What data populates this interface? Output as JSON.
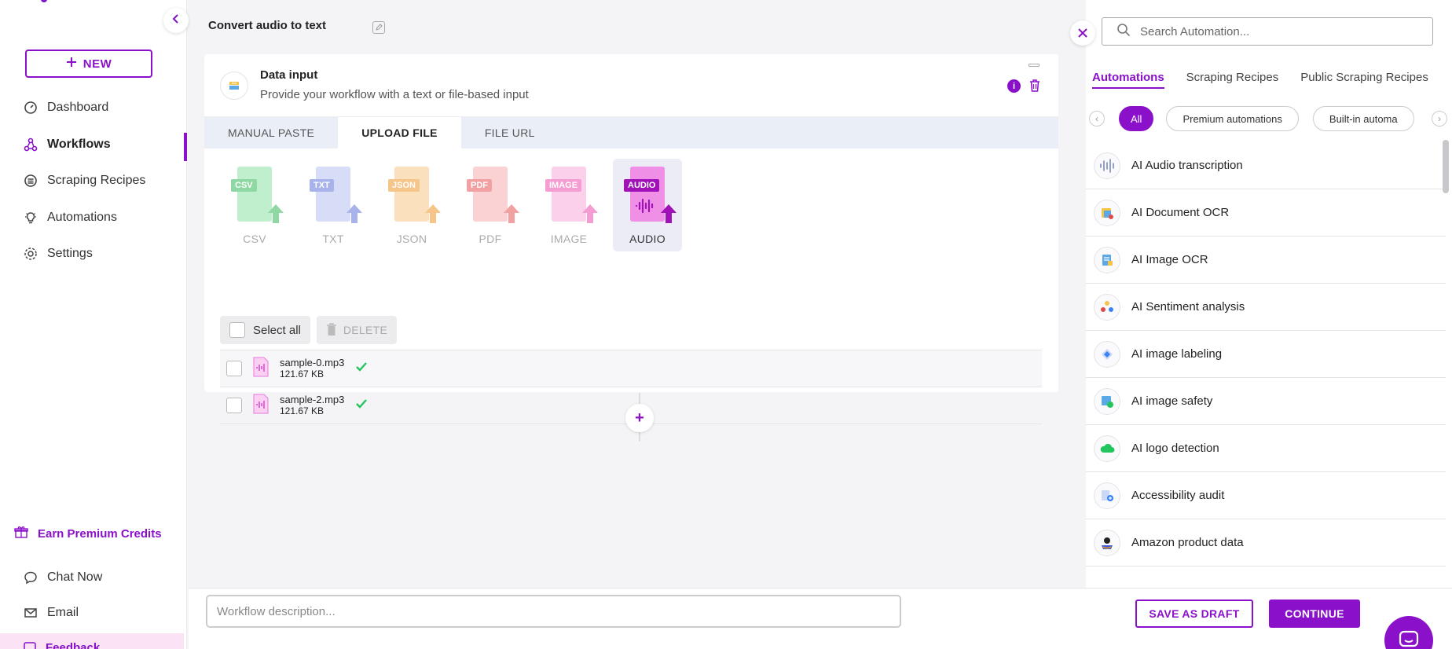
{
  "colors": {
    "accent": "#8a10c9",
    "csv": "#9fe2b0",
    "txt": "#aab6ee",
    "json": "#f7c98c",
    "pdf": "#f6aeb0",
    "image": "#f6a8d8",
    "audio": "#e77adf"
  },
  "sidebar": {
    "new_label": "NEW",
    "items": [
      {
        "label": "Dashboard",
        "icon": "dashboard-icon"
      },
      {
        "label": "Workflows",
        "icon": "workflows-icon",
        "active": true
      },
      {
        "label": "Scraping Recipes",
        "icon": "recipes-icon"
      },
      {
        "label": "Automations",
        "icon": "bulb-icon"
      },
      {
        "label": "Settings",
        "icon": "gear-icon"
      }
    ],
    "earn_label": "Earn Premium Credits",
    "bottom_items": [
      {
        "label": "Chat Now",
        "icon": "chat-icon"
      },
      {
        "label": "Email",
        "icon": "mail-icon"
      }
    ],
    "feedback_label": "Feedback"
  },
  "workflow": {
    "title": "Convert audio to text"
  },
  "card": {
    "title": "Data input",
    "subtitle": "Provide your workflow with a text or file-based input",
    "tabs": [
      "MANUAL PASTE",
      "UPLOAD FILE",
      "FILE URL"
    ],
    "active_tab": 1,
    "file_types": [
      {
        "label": "CSV",
        "badge": "CSV"
      },
      {
        "label": "TXT",
        "badge": "TXT"
      },
      {
        "label": "JSON",
        "badge": "JSON"
      },
      {
        "label": "PDF",
        "badge": "PDF"
      },
      {
        "label": "IMAGE",
        "badge": "IMAGE"
      },
      {
        "label": "AUDIO",
        "badge": "AUDIO"
      }
    ],
    "select_all_label": "Select all",
    "delete_label": "DELETE",
    "files": [
      {
        "name": "sample-0.mp3",
        "size": "121.67 KB"
      },
      {
        "name": "sample-2.mp3",
        "size": "121.67 KB"
      }
    ]
  },
  "panel": {
    "search_placeholder": "Search Automation...",
    "tabs": [
      "Automations",
      "Scraping Recipes",
      "Public Scraping Recipes"
    ],
    "chips": [
      "All",
      "Premium automations",
      "Built-in automa"
    ],
    "automations": [
      {
        "label": "AI Audio transcription",
        "icon": "audio-wave-icon"
      },
      {
        "label": "AI Document OCR",
        "icon": "document-ocr-icon"
      },
      {
        "label": "AI Image OCR",
        "icon": "image-ocr-icon"
      },
      {
        "label": "AI Sentiment analysis",
        "icon": "sentiment-icon"
      },
      {
        "label": "AI image labeling",
        "icon": "label-icon"
      },
      {
        "label": "AI image safety",
        "icon": "shield-image-icon"
      },
      {
        "label": "AI logo detection",
        "icon": "cloud-logo-icon"
      },
      {
        "label": "Accessibility audit",
        "icon": "accessibility-icon"
      },
      {
        "label": "Amazon product data",
        "icon": "amazon-icon"
      }
    ]
  },
  "footer": {
    "description_placeholder": "Workflow description...",
    "save_draft_label": "SAVE AS DRAFT",
    "continue_label": "CONTINUE"
  }
}
